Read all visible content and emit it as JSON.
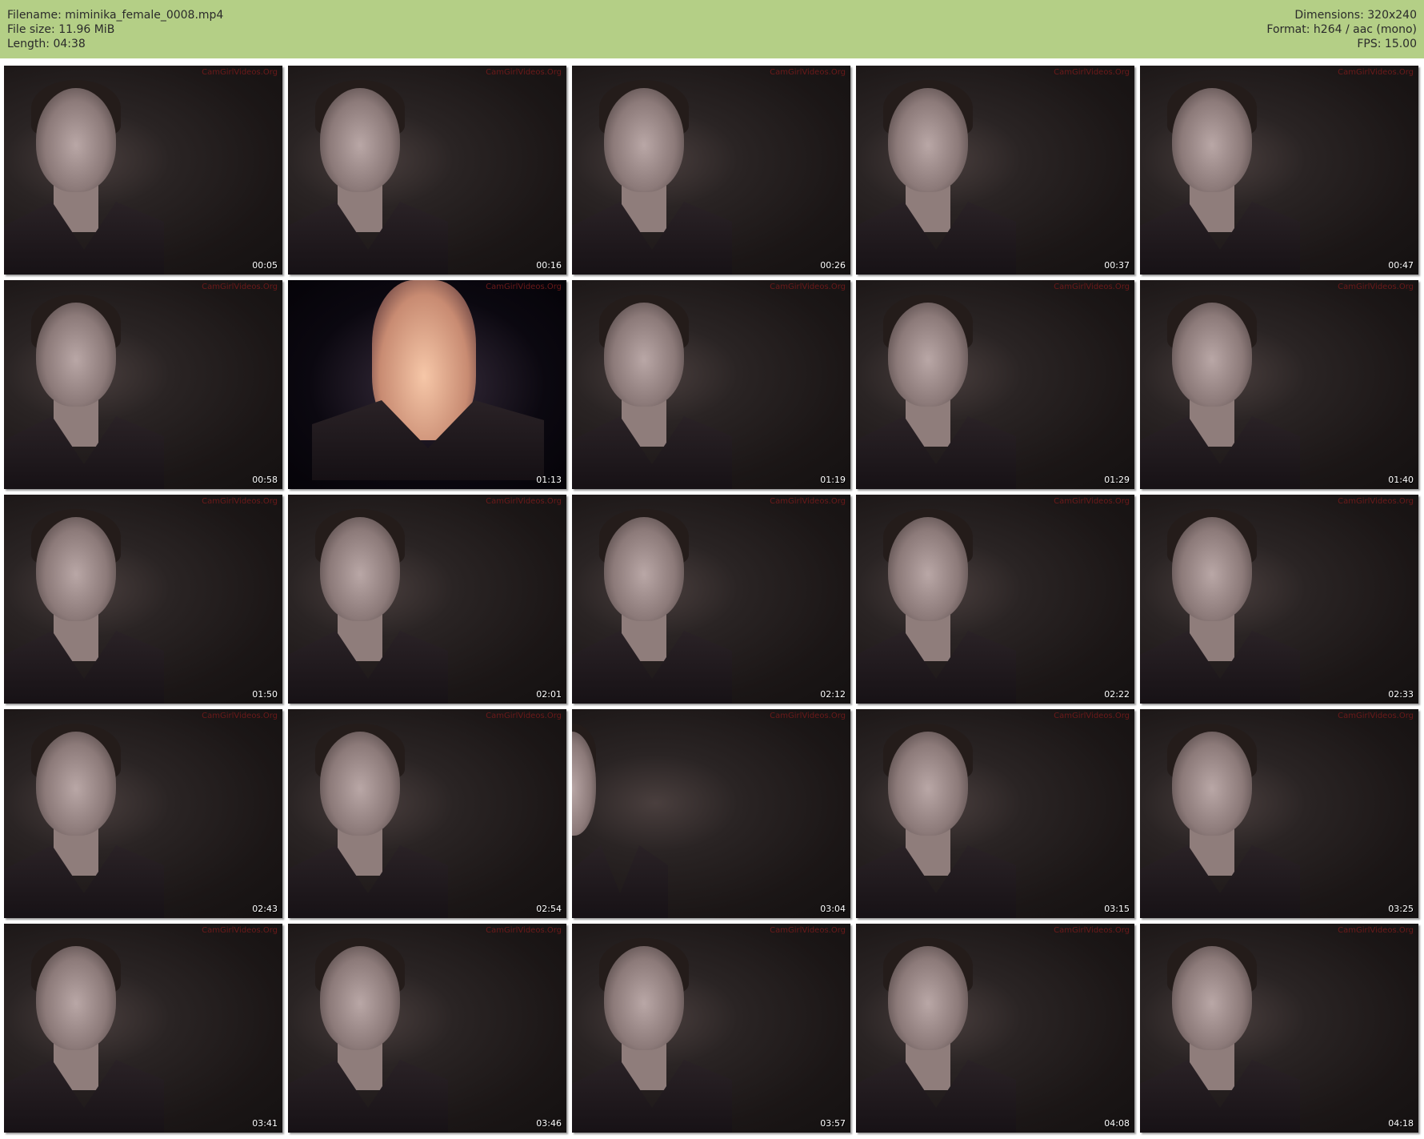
{
  "header": {
    "filename": "Filename: miminika_female_0008.mp4",
    "filesize": "File size: 11.96 MiB",
    "length": "Length: 04:38",
    "dimensions": "Dimensions: 320x240",
    "format": "Format: h264 / aac (mono)",
    "fps": "FPS: 15.00"
  },
  "thumbnails": [
    {
      "time": "00:05"
    },
    {
      "time": "00:16"
    },
    {
      "time": "00:26"
    },
    {
      "time": "00:37"
    },
    {
      "time": "00:47"
    },
    {
      "time": "00:58"
    },
    {
      "time": "01:13"
    },
    {
      "time": "01:19"
    },
    {
      "time": "01:29"
    },
    {
      "time": "01:40"
    },
    {
      "time": "01:50"
    },
    {
      "time": "02:01"
    },
    {
      "time": "02:12"
    },
    {
      "time": "02:22"
    },
    {
      "time": "02:33"
    },
    {
      "time": "02:43"
    },
    {
      "time": "02:54"
    },
    {
      "time": "03:04"
    },
    {
      "time": "03:15"
    },
    {
      "time": "03:25"
    },
    {
      "time": "03:41"
    },
    {
      "time": "03:46"
    },
    {
      "time": "03:57"
    },
    {
      "time": "04:08"
    },
    {
      "time": "04:18"
    }
  ],
  "watermark": "CamGirlVideos.Org"
}
